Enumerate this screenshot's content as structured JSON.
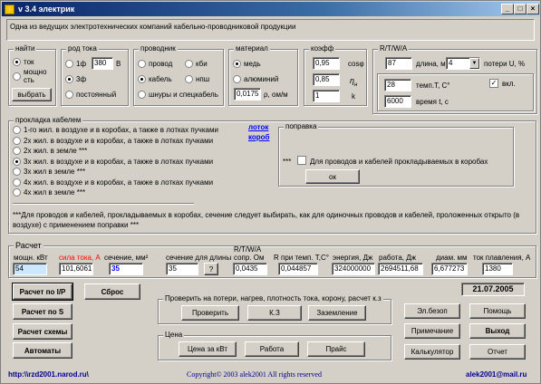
{
  "window": {
    "title": "v 3.4   электрик",
    "min": "_",
    "max": "□",
    "close": "×"
  },
  "banner": "Одна из ведущих электротехнических компаний кабельно-проводниковой продукции",
  "find": {
    "title": "найти",
    "opt1": "ток",
    "opt2": "мощно сть",
    "button": "выбрать"
  },
  "current": {
    "title": "род тока",
    "opt1": "1ф",
    "voltage": "380",
    "unit": "В",
    "opt2": "3ф",
    "opt3": "постоянный"
  },
  "conductor": {
    "title": "проводник",
    "opt1": "провод",
    "opt2": "кби",
    "opt3": "кабель",
    "opt4": "нпш",
    "opt5": "шнуры и спецкабель"
  },
  "material": {
    "title": "материал",
    "opt1": "медь",
    "opt2": "алюминий",
    "rho_value": "0,0175",
    "rho_label": "ρ, ом/м"
  },
  "coef": {
    "title": "коэфф",
    "v1": "0,95",
    "l1": "cosφ",
    "v2": "0,85",
    "l2": "η",
    "l2sub": "н",
    "v3": "1",
    "l3": "k"
  },
  "rtwa": {
    "title": "R/T/W/A",
    "length_val": "87",
    "length_label": "длина, м",
    "loss_select": "4",
    "loss_label": "потери U, %",
    "temp_val": "28",
    "temp_label": "темп.Т, С°",
    "on_label": "вкл.",
    "on_mark": "✓",
    "time_val": "6000",
    "time_label": "время t, с"
  },
  "laying": {
    "title": "прокладка кабелем",
    "options": [
      "1-го жил. в воздухе и в коробах, а также в лотках пучками",
      "2х жил. в воздухе и в коробах, а также в лотках пучками",
      "2х жил. в земле ***",
      "3х жил. в воздухе и в коробах, а также в лотках пучками",
      "3х жил в земле ***",
      "4х жил. в воздухе и в коробах, а также в лотках пучками",
      "4х жил в земле ***"
    ],
    "link1": "лоток",
    "link2": "короб",
    "note": "***Для проводов и кабелей, прокладываемых в коробах, сечение следует выбирать, как для одиночных проводов и кабелей, проложенных открыто (в воздухе) с применением поправки ***"
  },
  "correction": {
    "title": "поправка",
    "mark": "***",
    "check_label": "Для проводов и кабелей прокладываемых в коробах",
    "ok": "ок"
  },
  "calc": {
    "title": "Расчет",
    "power_label": "мощн. кВт",
    "power": "54",
    "current_label": "сила тока, А",
    "current": "101,6061",
    "section_label": "сечение, мм²",
    "section": "35",
    "section_len_label": "сечение для длины",
    "section_len": "35",
    "q": "?",
    "rtwa_label": "R/T/W/A",
    "resist_label": "сопр. Ом",
    "resist": "0,0435",
    "rtemp_label": "R при темп. Т,С°",
    "rtemp": "0,044857",
    "energy_label": "энергия, Дж",
    "energy": "324000000",
    "work_label": "работа, Дж",
    "work": "2694511,68",
    "diam_label": "диам. мм",
    "diam": "6,677273",
    "melt_label": "ток плавления, А",
    "melt": "1380"
  },
  "buttons": {
    "calc_ip": "Расчет по I/P",
    "reset": "Сброс",
    "calc_s": "Расчет по S",
    "calc_schemes": "Расчет схемы",
    "automats": "Автоматы"
  },
  "check": {
    "title": "Проверить на потери, нагрев, плотность тока, корону, расчет к.з",
    "verify": "Проверить",
    "kz": "К.З",
    "ground": "Заземление"
  },
  "price": {
    "title": "Цена",
    "per_kw": "Цена за кВт",
    "work": "Работа",
    "list": "Прайс"
  },
  "date": "21.07.2005",
  "side": {
    "safety": "Эл.безоп",
    "help": "Помощь",
    "note": "Примечание",
    "exit": "Выход",
    "calc": "Калькулятор",
    "report": "Отчет"
  },
  "footer": {
    "url": "http:\\\\rzd2001.narod.ru\\",
    "copyright": "Copyright© 2003 alek2001 All rights reserved",
    "email": "alek2001@mail.ru"
  },
  "colors": {
    "title_start": "#0a246a",
    "link": "#0000ff",
    "current_label": "#ff0000",
    "highlight_field": "#cce8ff"
  }
}
